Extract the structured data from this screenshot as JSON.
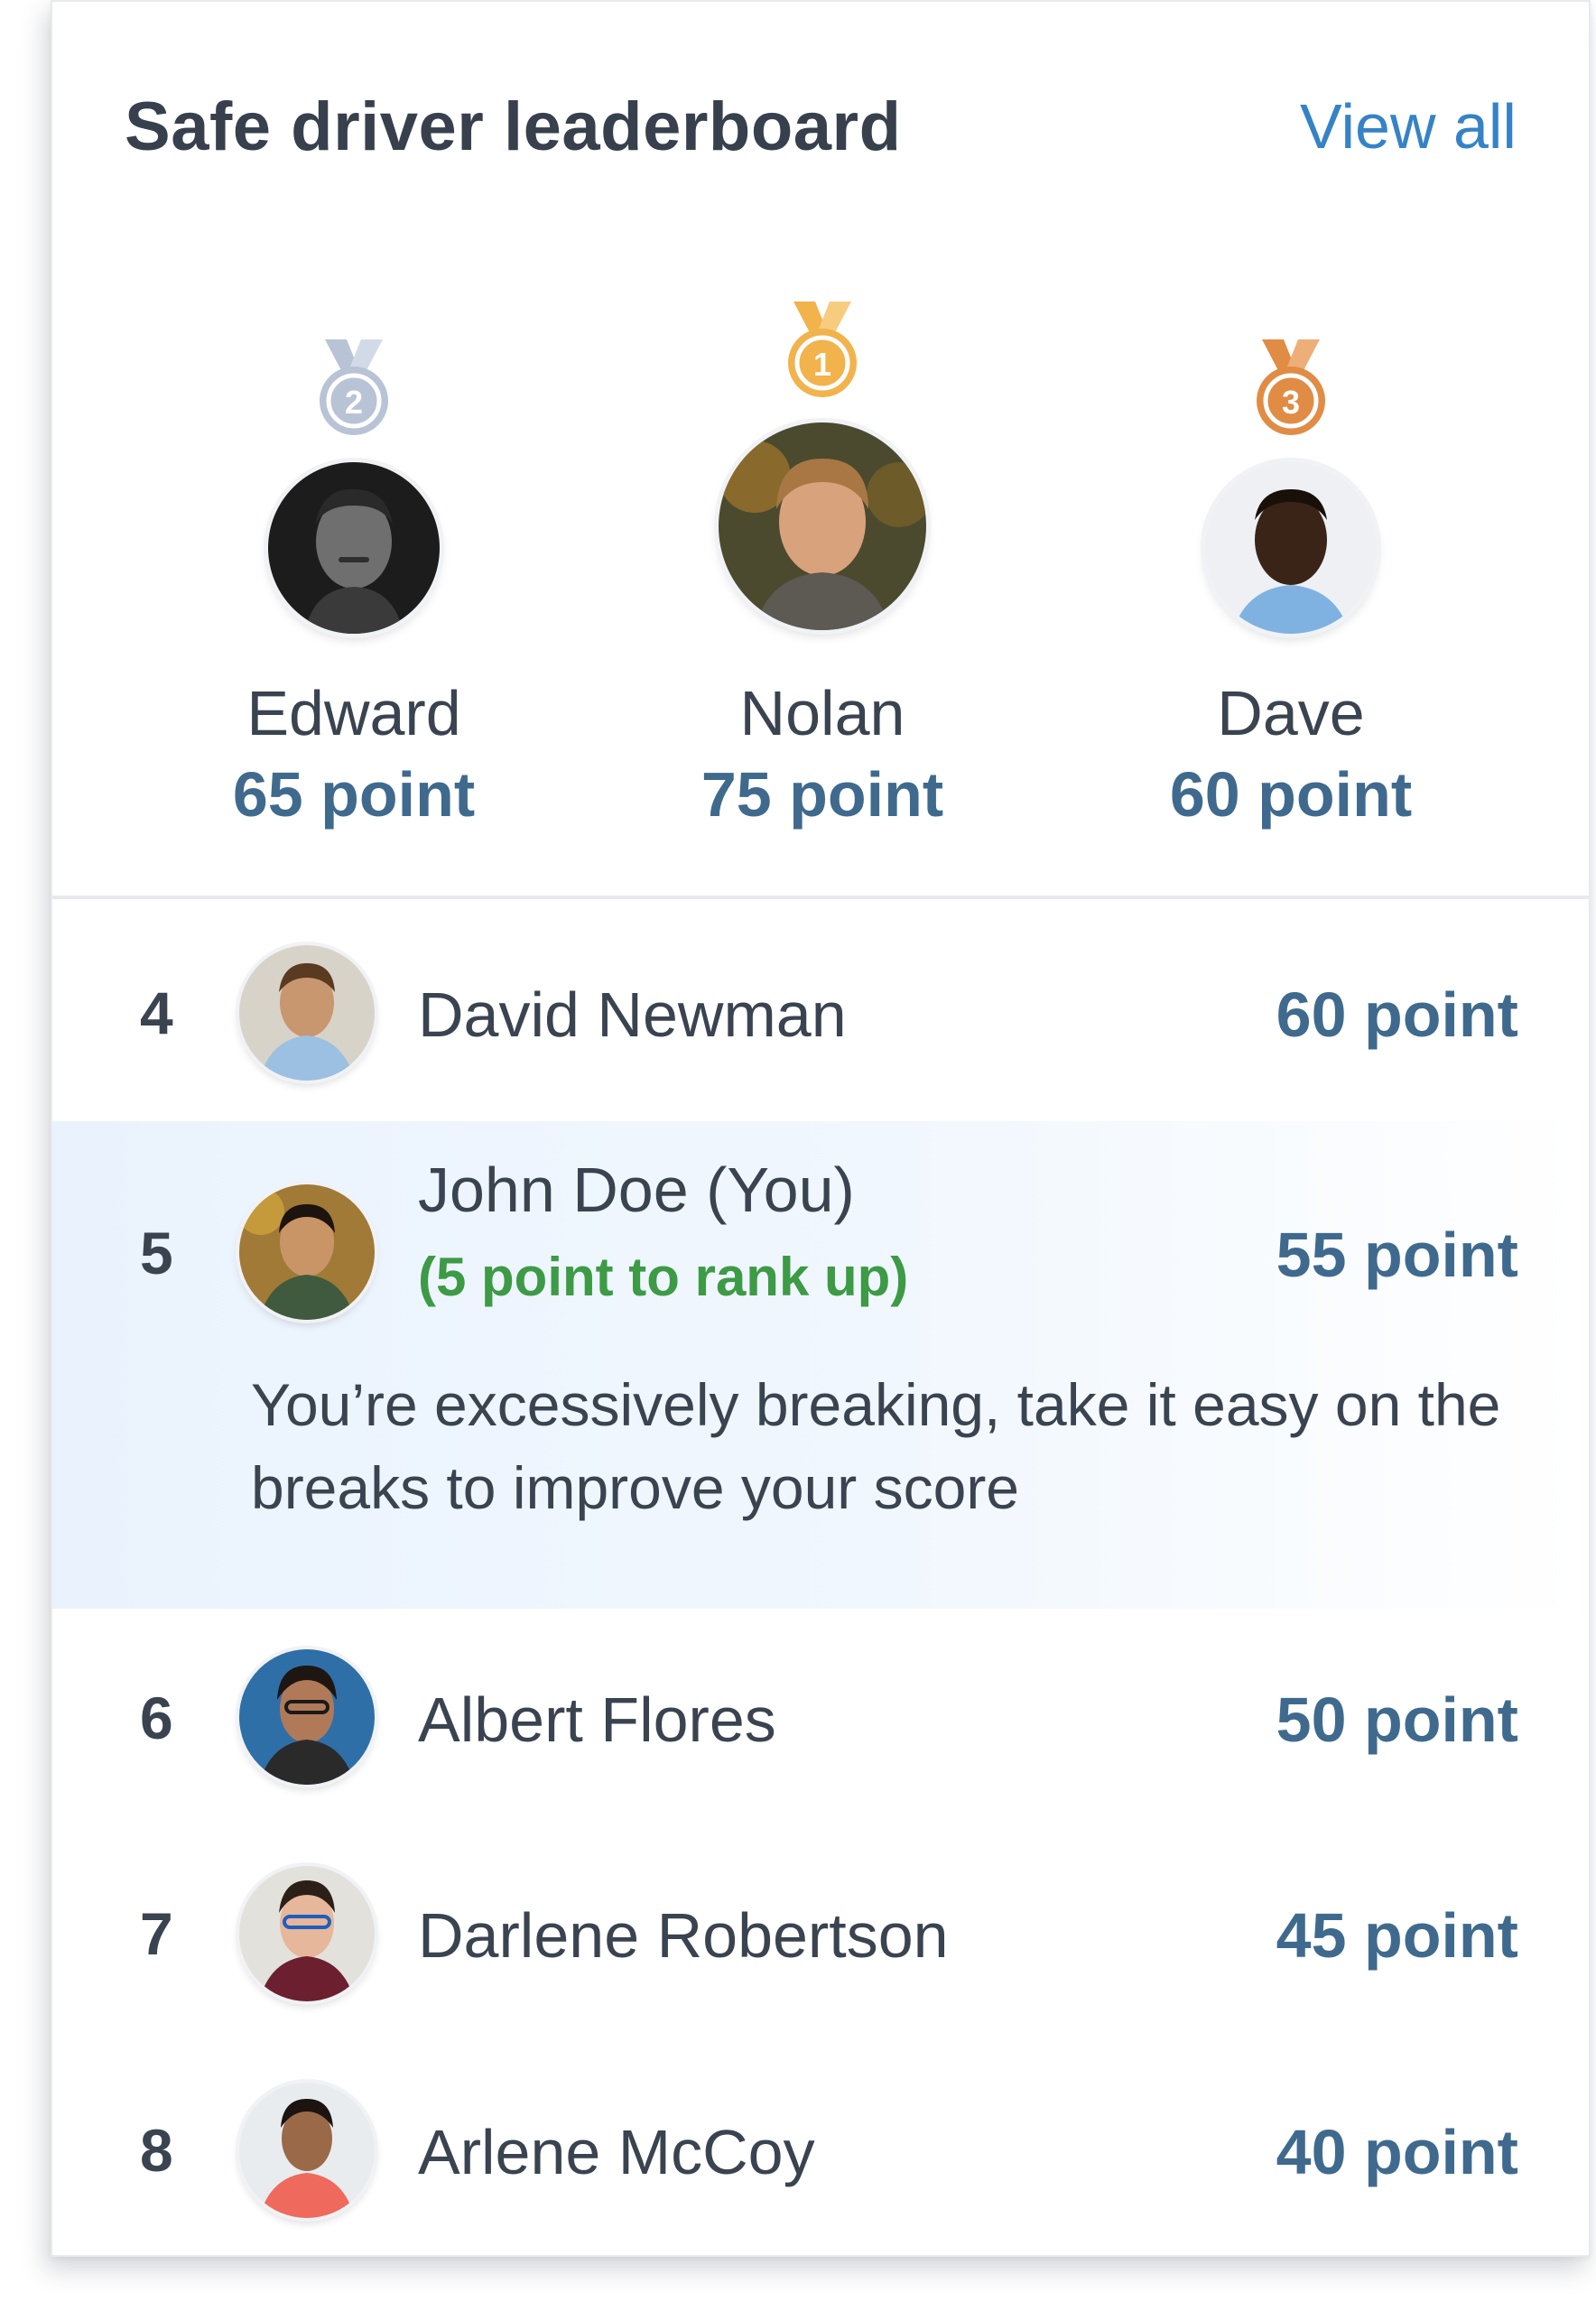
{
  "header": {
    "title": "Safe driver leaderboard",
    "view_all": "View all"
  },
  "podium": [
    {
      "rank": "2",
      "name": "Edward",
      "points": "65 point",
      "medal_color": "#b9c3d6"
    },
    {
      "rank": "1",
      "name": "Nolan",
      "points": "75 point",
      "medal_color": "#f2b24c"
    },
    {
      "rank": "3",
      "name": "Dave",
      "points": "60 point",
      "medal_color": "#e08c45"
    }
  ],
  "leaderboard": [
    {
      "rank": "4",
      "name": "David Newman",
      "points": "60 point"
    },
    {
      "rank": "5",
      "name": "John Doe (You)",
      "points": "55 point",
      "note": "(5 point to rank up)",
      "tip": "You’re excessively breaking, take it easy on the breaks to improve your score"
    },
    {
      "rank": "6",
      "name": "Albert Flores",
      "points": "50 point"
    },
    {
      "rank": "7",
      "name": "Darlene Robertson",
      "points": "45 point"
    },
    {
      "rank": "8",
      "name": "Arlene McCoy",
      "points": "40 point"
    }
  ],
  "colors": {
    "points": "#3f6a8e",
    "link": "#3583c6",
    "rankup": "#3d9a45",
    "highlight": "#eaf3fd"
  }
}
